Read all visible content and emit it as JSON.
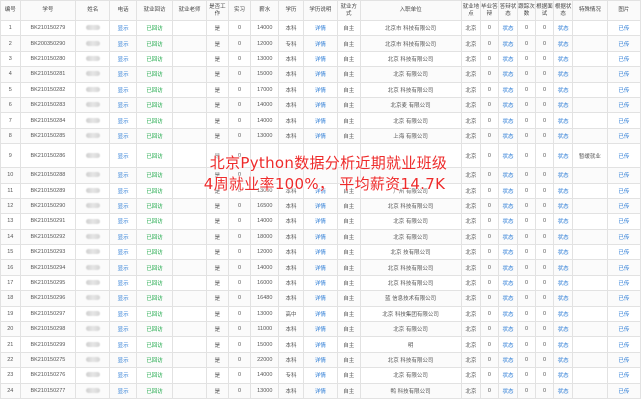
{
  "overlay": {
    "line1": "北京Python数据分析近期就业班级",
    "line2": "4周就业率100%，  平均薪资14.7K"
  },
  "headers": [
    "编号",
    "学号",
    "姓名",
    "电话",
    "就业回访",
    "就业老师",
    "是否工作",
    "实习",
    "薪水",
    "学历",
    "学历说明",
    "就业方式",
    "入职单位",
    "就业地点",
    "毕业答辩",
    "答辩状态",
    "跟踪次数",
    "根据面试",
    "根据状态",
    "特殊情况",
    "图片"
  ],
  "colors": {
    "link": "#2a7bd6",
    "status": "#1fa94a",
    "overlay": "#ee2b2b"
  },
  "rows": [
    {
      "id": "1",
      "sid": "BK210150279",
      "phone": "显示",
      "visit": "已回访",
      "work": "是",
      "intern": "0",
      "salary": "14000",
      "edu": "本科",
      "note": "详情",
      "mode": "自主",
      "company": "北京市 科技有限公司",
      "place": "北京",
      "defense": "0",
      "dstate": "状态",
      "track": "0",
      "iv": "0",
      "istate": "状态",
      "special": "",
      "pic": "已传"
    },
    {
      "id": "2",
      "sid": "BK200350290",
      "phone": "显示",
      "visit": "已回访",
      "work": "是",
      "intern": "0",
      "salary": "12000",
      "edu": "专科",
      "note": "详情",
      "mode": "自主",
      "company": "北京市 科技有限公司",
      "place": "北京",
      "defense": "0",
      "dstate": "状态",
      "track": "0",
      "iv": "0",
      "istate": "状态",
      "special": "",
      "pic": "已传"
    },
    {
      "id": "3",
      "sid": "BK210150280",
      "phone": "显示",
      "visit": "已回访",
      "work": "是",
      "intern": "0",
      "salary": "13000",
      "edu": "本科",
      "note": "详情",
      "mode": "自主",
      "company": "北京 科技有限公司",
      "place": "北京",
      "defense": "0",
      "dstate": "状态",
      "track": "0",
      "iv": "0",
      "istate": "状态",
      "special": "",
      "pic": "已传"
    },
    {
      "id": "4",
      "sid": "BK210150281",
      "phone": "显示",
      "visit": "已回访",
      "work": "是",
      "intern": "0",
      "salary": "15000",
      "edu": "本科",
      "note": "详情",
      "mode": "自主",
      "company": "北京 有限公司",
      "place": "北京",
      "defense": "0",
      "dstate": "状态",
      "track": "0",
      "iv": "0",
      "istate": "状态",
      "special": "",
      "pic": "已传"
    },
    {
      "id": "5",
      "sid": "BK210150282",
      "phone": "显示",
      "visit": "已回访",
      "work": "是",
      "intern": "0",
      "salary": "17000",
      "edu": "本科",
      "note": "详情",
      "mode": "自主",
      "company": "北京 科技有限公司",
      "place": "北京",
      "defense": "0",
      "dstate": "状态",
      "track": "0",
      "iv": "0",
      "istate": "状态",
      "special": "",
      "pic": "已传"
    },
    {
      "id": "6",
      "sid": "BK210150283",
      "phone": "显示",
      "visit": "已回访",
      "work": "是",
      "intern": "0",
      "salary": "14000",
      "edu": "本科",
      "note": "详情",
      "mode": "自主",
      "company": "北京麦 有限公司",
      "place": "北京",
      "defense": "0",
      "dstate": "状态",
      "track": "0",
      "iv": "0",
      "istate": "状态",
      "special": "",
      "pic": "已传"
    },
    {
      "id": "7",
      "sid": "BK210150284",
      "phone": "显示",
      "visit": "已回访",
      "work": "是",
      "intern": "0",
      "salary": "14000",
      "edu": "本科",
      "note": "详情",
      "mode": "自主",
      "company": "北京 有限公司",
      "place": "北京",
      "defense": "0",
      "dstate": "状态",
      "track": "0",
      "iv": "0",
      "istate": "状态",
      "special": "",
      "pic": "已传"
    },
    {
      "id": "8",
      "sid": "BK210150285",
      "phone": "显示",
      "visit": "已回访",
      "work": "是",
      "intern": "0",
      "salary": "13000",
      "edu": "本科",
      "note": "详情",
      "mode": "自主",
      "company": "上海 有限公司",
      "place": "北京",
      "defense": "0",
      "dstate": "状态",
      "track": "0",
      "iv": "0",
      "istate": "状态",
      "special": "",
      "pic": "已传"
    },
    {
      "id": "9",
      "sid": "BK210150286",
      "phone": "显示",
      "visit": "已回访",
      "work": "是",
      "intern": "0",
      "salary": "",
      "edu": "",
      "note": "",
      "mode": "",
      "company": "",
      "place": "北京",
      "defense": "0",
      "dstate": "状态",
      "track": "0",
      "iv": "0",
      "istate": "状态",
      "special": "暂缓就业",
      "pic": "已传",
      "tall": true
    },
    {
      "id": "10",
      "sid": "BK210150288",
      "phone": "显示",
      "visit": "已回访",
      "work": "是",
      "intern": "0",
      "salary": "",
      "edu": "",
      "note": "",
      "mode": "",
      "company": "",
      "place": "北京",
      "defense": "0",
      "dstate": "状态",
      "track": "0",
      "iv": "0",
      "istate": "状态",
      "special": "",
      "pic": "已传"
    },
    {
      "id": "11",
      "sid": "BK210150289",
      "phone": "显示",
      "visit": "已回访",
      "work": "是",
      "intern": "0",
      "salary": "13000",
      "edu": "本科",
      "note": "详情",
      "mode": "自主",
      "company": "广州 有限公司",
      "place": "北京",
      "defense": "0",
      "dstate": "状态",
      "track": "0",
      "iv": "0",
      "istate": "状态",
      "special": "",
      "pic": "已传"
    },
    {
      "id": "12",
      "sid": "BK210150290",
      "phone": "显示",
      "visit": "已回访",
      "work": "是",
      "intern": "0",
      "salary": "16500",
      "edu": "本科",
      "note": "详情",
      "mode": "自主",
      "company": "北京 科技有限公司",
      "place": "北京",
      "defense": "0",
      "dstate": "状态",
      "track": "0",
      "iv": "0",
      "istate": "状态",
      "special": "",
      "pic": "已传"
    },
    {
      "id": "13",
      "sid": "BK210150291",
      "phone": "显示",
      "visit": "已回访",
      "work": "是",
      "intern": "0",
      "salary": "14000",
      "edu": "本科",
      "note": "详情",
      "mode": "自主",
      "company": "北京 有限公司",
      "place": "北京",
      "defense": "0",
      "dstate": "状态",
      "track": "0",
      "iv": "0",
      "istate": "状态",
      "special": "",
      "pic": "已传"
    },
    {
      "id": "14",
      "sid": "BK210150292",
      "phone": "显示",
      "visit": "已回访",
      "work": "是",
      "intern": "0",
      "salary": "18000",
      "edu": "本科",
      "note": "详情",
      "mode": "自主",
      "company": "北京 有限公司",
      "place": "北京",
      "defense": "0",
      "dstate": "状态",
      "track": "0",
      "iv": "0",
      "istate": "状态",
      "special": "",
      "pic": "已传"
    },
    {
      "id": "15",
      "sid": "BK210150293",
      "phone": "显示",
      "visit": "已回访",
      "work": "是",
      "intern": "0",
      "salary": "12000",
      "edu": "本科",
      "note": "详情",
      "mode": "自主",
      "company": "北京 技有限公司",
      "place": "北京",
      "defense": "0",
      "dstate": "状态",
      "track": "0",
      "iv": "0",
      "istate": "状态",
      "special": "",
      "pic": "已传"
    },
    {
      "id": "16",
      "sid": "BK210150294",
      "phone": "显示",
      "visit": "已回访",
      "work": "是",
      "intern": "0",
      "salary": "14000",
      "edu": "本科",
      "note": "详情",
      "mode": "自主",
      "company": "北京 科技有限公司",
      "place": "北京",
      "defense": "0",
      "dstate": "状态",
      "track": "0",
      "iv": "0",
      "istate": "状态",
      "special": "",
      "pic": "已传"
    },
    {
      "id": "17",
      "sid": "BK210150295",
      "phone": "显示",
      "visit": "已回访",
      "work": "是",
      "intern": "0",
      "salary": "16000",
      "edu": "本科",
      "note": "详情",
      "mode": "自主",
      "company": "北京 科技有限公司",
      "place": "北京",
      "defense": "0",
      "dstate": "状态",
      "track": "0",
      "iv": "0",
      "istate": "状态",
      "special": "",
      "pic": "已传"
    },
    {
      "id": "18",
      "sid": "BK210150296",
      "phone": "显示",
      "visit": "已回访",
      "work": "是",
      "intern": "0",
      "salary": "16480",
      "edu": "本科",
      "note": "详情",
      "mode": "自主",
      "company": "蓝 信息技术有限公司",
      "place": "北京",
      "defense": "0",
      "dstate": "状态",
      "track": "0",
      "iv": "0",
      "istate": "状态",
      "special": "",
      "pic": "已传"
    },
    {
      "id": "19",
      "sid": "BK210150297",
      "phone": "显示",
      "visit": "已回访",
      "work": "是",
      "intern": "0",
      "salary": "13000",
      "edu": "高中",
      "note": "详情",
      "mode": "自主",
      "company": "北京 科技集团有限公司",
      "place": "北京",
      "defense": "0",
      "dstate": "状态",
      "track": "0",
      "iv": "0",
      "istate": "状态",
      "special": "",
      "pic": "已传"
    },
    {
      "id": "20",
      "sid": "BK210150298",
      "phone": "显示",
      "visit": "已回访",
      "work": "是",
      "intern": "0",
      "salary": "11000",
      "edu": "本科",
      "note": "详情",
      "mode": "自主",
      "company": "北京 有限公司",
      "place": "北京",
      "defense": "0",
      "dstate": "状态",
      "track": "0",
      "iv": "0",
      "istate": "状态",
      "special": "",
      "pic": "已传"
    },
    {
      "id": "21",
      "sid": "BK210150299",
      "phone": "显示",
      "visit": "已回访",
      "work": "是",
      "intern": "0",
      "salary": "15000",
      "edu": "本科",
      "note": "详情",
      "mode": "自主",
      "company": "明 ",
      "place": "北京",
      "defense": "0",
      "dstate": "状态",
      "track": "0",
      "iv": "0",
      "istate": "状态",
      "special": "",
      "pic": "已传"
    },
    {
      "id": "22",
      "sid": "BK210150275",
      "phone": "显示",
      "visit": "已回访",
      "work": "是",
      "intern": "0",
      "salary": "22000",
      "edu": "本科",
      "note": "详情",
      "mode": "自主",
      "company": "北京 科技有限公司",
      "place": "北京",
      "defense": "0",
      "dstate": "状态",
      "track": "0",
      "iv": "0",
      "istate": "状态",
      "special": "",
      "pic": "已传"
    },
    {
      "id": "23",
      "sid": "BK210150276",
      "phone": "显示",
      "visit": "已回访",
      "work": "是",
      "intern": "0",
      "salary": "14000",
      "edu": "专科",
      "note": "详情",
      "mode": "自主",
      "company": "北京 有限公司",
      "place": "北京",
      "defense": "0",
      "dstate": "状态",
      "track": "0",
      "iv": "0",
      "istate": "状态",
      "special": "",
      "pic": "已传"
    },
    {
      "id": "24",
      "sid": "BK210150277",
      "phone": "显示",
      "visit": "已回访",
      "work": "是",
      "intern": "0",
      "salary": "13000",
      "edu": "本科",
      "note": "详情",
      "mode": "自主",
      "company": "鸭 科技有限公司",
      "place": "北京",
      "defense": "0",
      "dstate": "状态",
      "track": "0",
      "iv": "0",
      "istate": "状态",
      "special": "",
      "pic": "已传"
    }
  ]
}
